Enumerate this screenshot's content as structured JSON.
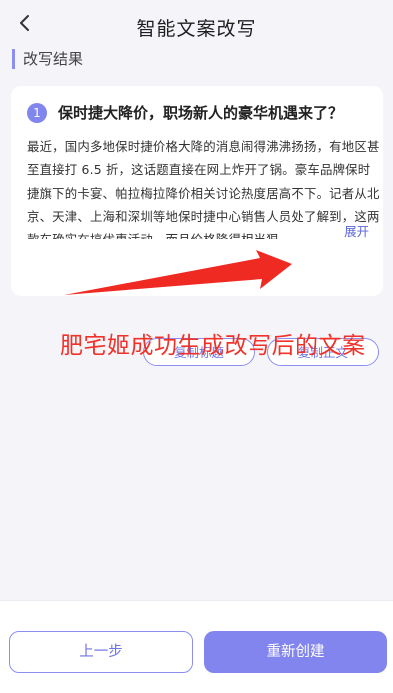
{
  "header": {
    "title": "智能文案改写",
    "back_icon": "chevron-left-icon"
  },
  "section": {
    "label": "改写结果"
  },
  "result_card": {
    "index": "1",
    "title": "保时捷大降价，职场新人的豪华机遇来了？",
    "body": "最近，国内多地保时捷价格大降的消息闹得沸沸扬扬，有地区甚至直接打 6.5 折，这话题直接在网上炸开了锅。豪车品牌保时捷旗下的卡宴、帕拉梅拉降价相关讨论热度居高不下。记者从北京、天津、上海和深圳等地保时捷中心销售人员处了解到，这两款车确实在搞优惠活动，而且价格降得相当狠，",
    "expand_label": "展开",
    "copy_title_label": "复制标题",
    "copy_body_label": "复制正文"
  },
  "annotation": {
    "text": "肥宅姬成功生成改写后的文案",
    "color": "#f0322a"
  },
  "footer": {
    "prev_label": "上一步",
    "recreate_label": "重新创建"
  },
  "colors": {
    "accent": "#8385ee",
    "background": "#f4f4f9"
  }
}
